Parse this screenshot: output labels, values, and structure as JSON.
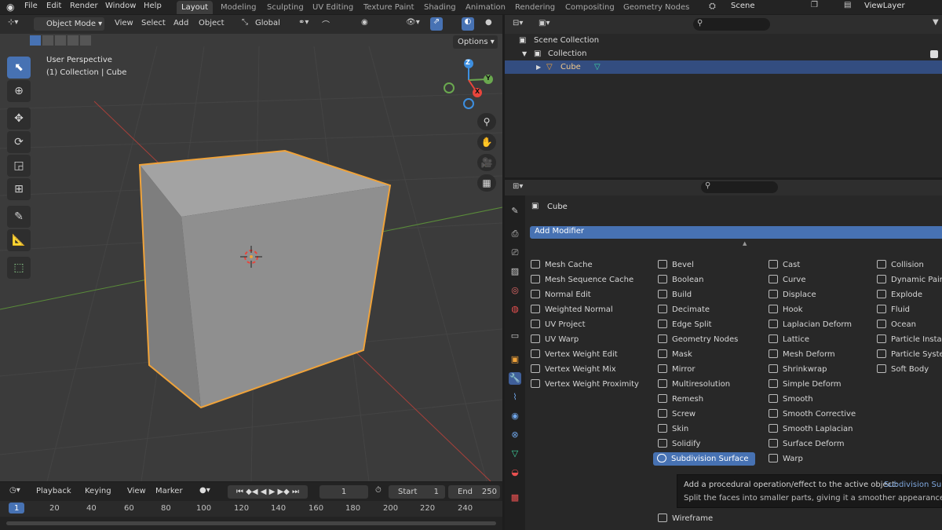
{
  "menubar": {
    "items": [
      "File",
      "Edit",
      "Render",
      "Window",
      "Help"
    ],
    "workspaces": [
      "Layout",
      "Modeling",
      "Sculpting",
      "UV Editing",
      "Texture Paint",
      "Shading",
      "Animation",
      "Rendering",
      "Compositing",
      "Geometry Nodes"
    ],
    "active_workspace": "Layout",
    "scene": "Scene",
    "view_layer": "ViewLayer"
  },
  "viewport": {
    "mode": "Object Mode",
    "menus": [
      "View",
      "Select",
      "Add",
      "Object"
    ],
    "orientation": "Global",
    "options": "Options",
    "overlay_line1": "User Perspective",
    "overlay_line2": "(1) Collection | Cube",
    "gizmo": {
      "z": "Z",
      "y": "Y",
      "x": "X"
    }
  },
  "timeline": {
    "menus": [
      "Playback",
      "Keying",
      "View",
      "Marker"
    ],
    "current_frame": "1",
    "start_label": "Start",
    "start": "1",
    "end_label": "End",
    "end": "250",
    "ticks": [
      "1",
      "20",
      "40",
      "60",
      "80",
      "100",
      "120",
      "140",
      "160",
      "180",
      "200",
      "220",
      "240"
    ]
  },
  "outliner": {
    "scene_collection": "Scene Collection",
    "collection": "Collection",
    "object": "Cube"
  },
  "properties": {
    "object_name": "Cube",
    "add_modifier": "Add Modifier",
    "col1": [
      "Mesh Cache",
      "Mesh Sequence Cache",
      "Normal Edit",
      "Weighted Normal",
      "UV Project",
      "UV Warp",
      "Vertex Weight Edit",
      "Vertex Weight Mix",
      "Vertex Weight Proximity"
    ],
    "col2": [
      "Bevel",
      "Boolean",
      "Build",
      "Decimate",
      "Edge Split",
      "Geometry Nodes",
      "Mask",
      "Mirror",
      "Multiresolution",
      "Remesh",
      "Screw",
      "Skin",
      "Solidify",
      "Subdivision Surface"
    ],
    "col2_bottom": "Wireframe",
    "col3": [
      "Cast",
      "Curve",
      "Displace",
      "Hook",
      "Laplacian Deform",
      "Lattice",
      "Mesh Deform",
      "Shrinkwrap",
      "Simple Deform",
      "Smooth",
      "Smooth Corrective",
      "Smooth Laplacian",
      "Surface Deform",
      "Warp"
    ],
    "col4": [
      "Collision",
      "Dynamic Paint",
      "Explode",
      "Fluid",
      "Ocean",
      "Particle Instance",
      "Particle System",
      "Soft Body"
    ],
    "selected": "Subdivision Surface",
    "tooltip_line1": "Add a procedural operation/effect to the active object:",
    "tooltip_name": "Subdivision Surface",
    "tooltip_line2": "Split the faces into smaller parts, giving it a smoother appearance"
  },
  "colors": {
    "accent": "#4772b3",
    "selection_outline": "#f0a33a",
    "axis_x": "#e8453c",
    "axis_y": "#6aa84f",
    "axis_z": "#3d8fe0"
  }
}
